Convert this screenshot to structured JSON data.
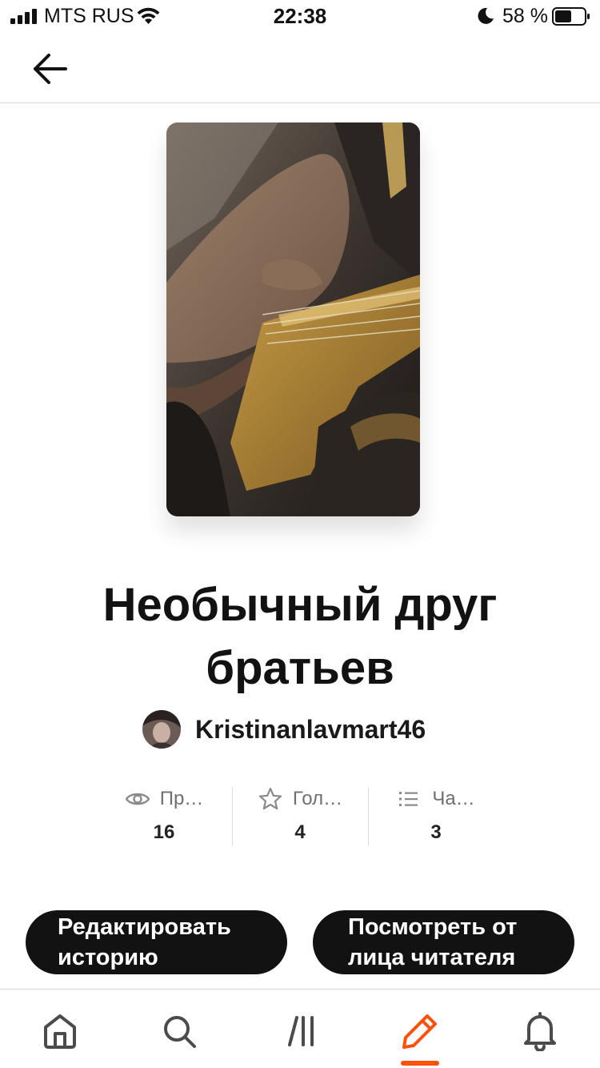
{
  "status_bar": {
    "carrier": "MTS RUS",
    "time": "22:38",
    "battery_percent": "58 %",
    "battery_level": 0.58,
    "icons": [
      "signal-icon",
      "wifi-icon",
      "moon-icon",
      "battery-icon"
    ]
  },
  "header": {
    "back_icon": "arrow-left-icon"
  },
  "story": {
    "cover_description_icon": "cover-image",
    "title": "Необычный друг братьев",
    "author": "Kristinanlavmart46"
  },
  "stats": [
    {
      "icon": "eye-icon",
      "label": "Пр…",
      "value": "16"
    },
    {
      "icon": "star-icon",
      "label": "Гол…",
      "value": "4"
    },
    {
      "icon": "list-icon",
      "label": "Ча…",
      "value": "3"
    }
  ],
  "actions": {
    "edit_label": "Редактировать историю",
    "preview_label": "Посмотреть от лица читателя"
  },
  "bottom_nav": {
    "items": [
      "home-icon",
      "search-icon",
      "library-icon",
      "pencil-icon",
      "bell-icon"
    ],
    "active": "pencil-icon"
  },
  "colors": {
    "accent": "#ff500a",
    "button_bg": "#121212",
    "text": "#121212",
    "muted": "#6f6f6f"
  }
}
